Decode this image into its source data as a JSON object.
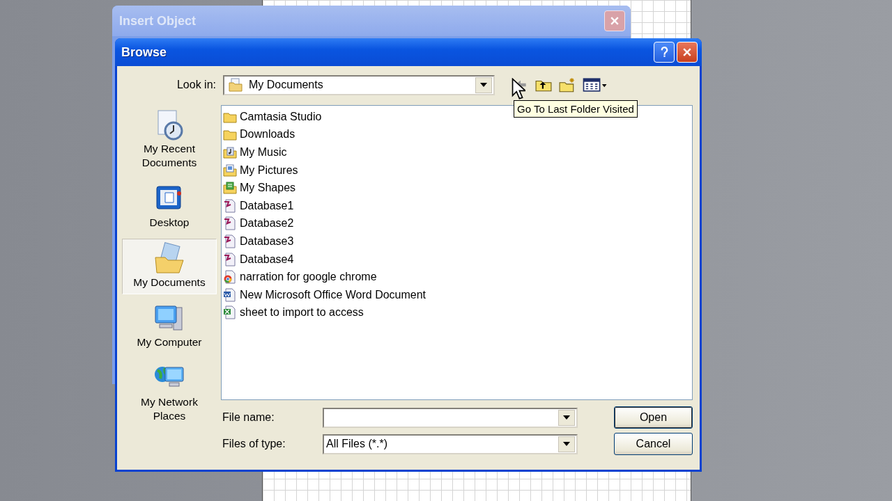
{
  "background_window": {
    "title": "Insert Object"
  },
  "dialog": {
    "title": "Browse"
  },
  "look_in": {
    "label": "Look in:",
    "value": "My Documents"
  },
  "tooltip": "Go To Last Folder Visited",
  "places": [
    {
      "label": "My Recent Documents",
      "kind": "recent",
      "selected": false
    },
    {
      "label": "Desktop",
      "kind": "desktop",
      "selected": false
    },
    {
      "label": "My Documents",
      "kind": "documents",
      "selected": true
    },
    {
      "label": "My Computer",
      "kind": "computer",
      "selected": false
    },
    {
      "label": "My Network Places",
      "kind": "network",
      "selected": false
    }
  ],
  "files": [
    {
      "name": "Camtasia Studio",
      "kind": "folder"
    },
    {
      "name": "Downloads",
      "kind": "folder"
    },
    {
      "name": "My Music",
      "kind": "music"
    },
    {
      "name": "My Pictures",
      "kind": "pictures"
    },
    {
      "name": "My Shapes",
      "kind": "shapes"
    },
    {
      "name": "Database1",
      "kind": "database"
    },
    {
      "name": "Database2",
      "kind": "database"
    },
    {
      "name": "Database3",
      "kind": "database"
    },
    {
      "name": "Database4",
      "kind": "database"
    },
    {
      "name": "narration for google chrome",
      "kind": "chrome"
    },
    {
      "name": "New Microsoft Office Word Document",
      "kind": "word"
    },
    {
      "name": "sheet to import to access",
      "kind": "excel"
    }
  ],
  "file_name": {
    "label": "File name:"
  },
  "file_type": {
    "label": "Files of type:",
    "value": "All Files (*.*)"
  },
  "buttons": [
    "Open",
    "Cancel"
  ]
}
